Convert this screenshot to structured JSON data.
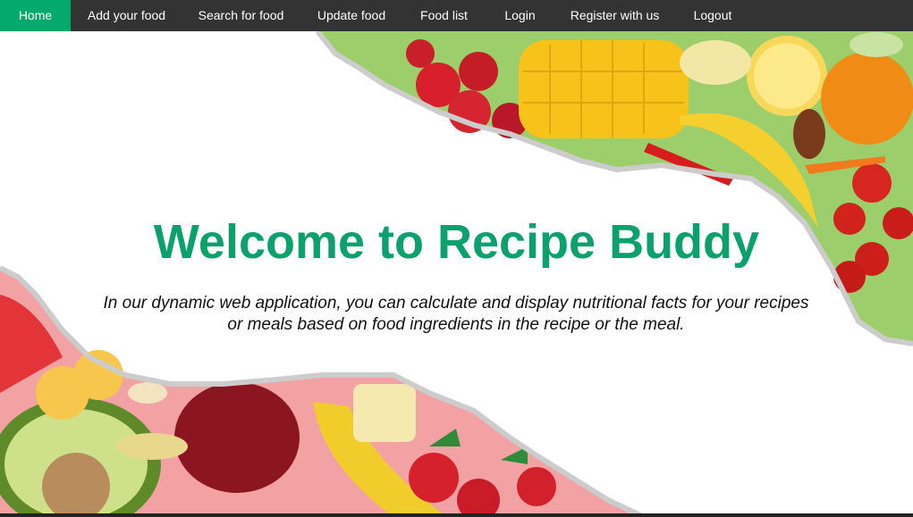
{
  "nav": {
    "items": [
      {
        "label": "Home"
      },
      {
        "label": "Add your food"
      },
      {
        "label": "Search for food"
      },
      {
        "label": "Update food"
      },
      {
        "label": "Food list"
      },
      {
        "label": "Login"
      },
      {
        "label": "Register with us"
      },
      {
        "label": "Logout"
      }
    ],
    "active_color": "#04AA6D",
    "bar_color": "#333333"
  },
  "hero": {
    "title": "Welcome to Recipe Buddy",
    "description": "In our dynamic web application, you can calculate and display nutritional facts for your recipes or meals based on food ingredients in the recipe or the meal.",
    "title_color": "#0aa16c"
  }
}
